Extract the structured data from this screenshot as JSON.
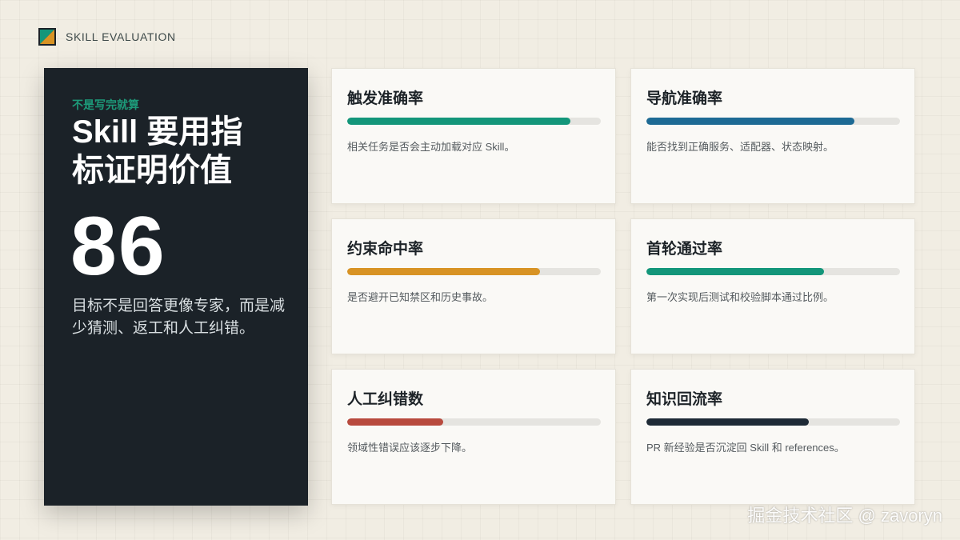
{
  "header": {
    "brand": "SKILL EVALUATION",
    "logo_icon": "square-diagonal-logo-icon"
  },
  "hero": {
    "kicker": "不是写完就算",
    "title": "Skill 要用指标证明价值",
    "score": "86",
    "description": "目标不是回答更像专家，而是减少猜测、返工和人工纠错。"
  },
  "metrics": [
    {
      "title": "触发准确率",
      "description": "相关任务是否会主动加载对应 Skill。",
      "progress": 0.88,
      "color": "#13967a"
    },
    {
      "title": "导航准确率",
      "description": "能否找到正确服务、适配器、状态映射。",
      "progress": 0.82,
      "color": "#1d6a94"
    },
    {
      "title": "约束命中率",
      "description": "是否避开已知禁区和历史事故。",
      "progress": 0.76,
      "color": "#d89324"
    },
    {
      "title": "首轮通过率",
      "description": "第一次实现后测试和校验脚本通过比例。",
      "progress": 0.7,
      "color": "#13967a"
    },
    {
      "title": "人工纠错数",
      "description": "领域性错误应该逐步下降。",
      "progress": 0.38,
      "color": "#b84a3e"
    },
    {
      "title": "知识回流率",
      "description": "PR 新经验是否沉淀回 Skill 和 references。",
      "progress": 0.64,
      "color": "#1e2a36"
    }
  ],
  "watermark": "掘金技术社区 @ zavoryn"
}
